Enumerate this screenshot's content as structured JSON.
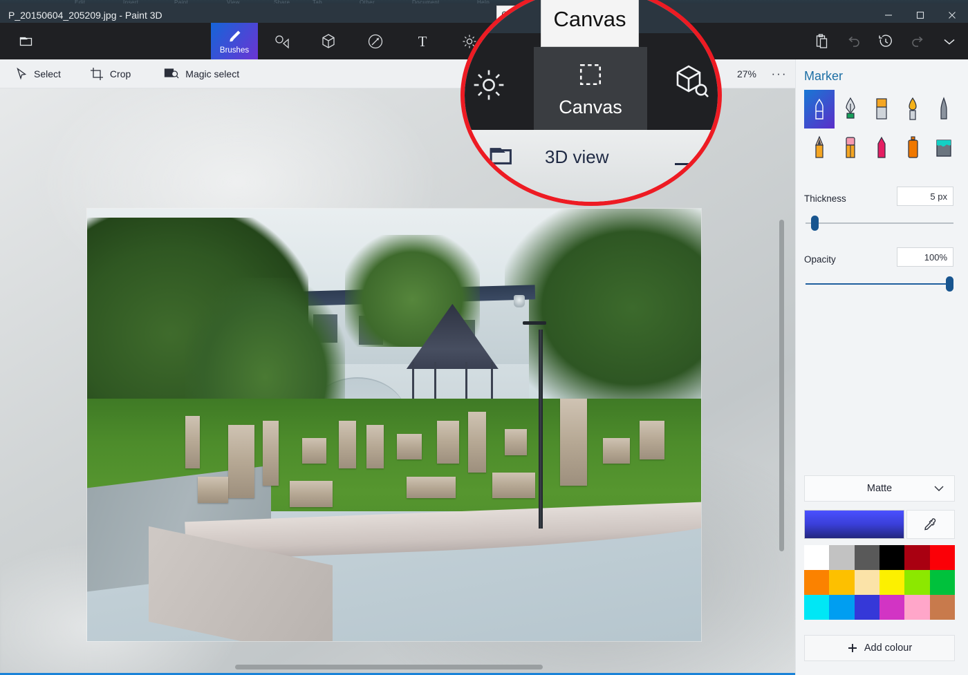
{
  "window": {
    "title": "P_20150604_205209.jpg  - Paint 3D",
    "controls": [
      {
        "name": "minimize",
        "glyph": "minimize-icon"
      },
      {
        "name": "maximize",
        "glyph": "maximize-icon"
      },
      {
        "name": "close",
        "glyph": "close-icon"
      }
    ],
    "behind_tabs": [
      "Edit",
      "Insert",
      "Paint",
      "View",
      "Share",
      "Tab",
      "Other",
      "Document",
      "Help"
    ]
  },
  "ribbon": {
    "menu_icon": "folder-icon",
    "tools": [
      {
        "label": "Brushes",
        "icon": "brush-icon",
        "active": true
      },
      {
        "label": "",
        "icon": "shapes-2d-icon",
        "active": false
      },
      {
        "label": "",
        "icon": "shapes-3d-icon",
        "active": false
      },
      {
        "label": "",
        "icon": "stickers-icon",
        "active": false
      },
      {
        "label": "",
        "icon": "text-icon",
        "active": false
      },
      {
        "label": "",
        "icon": "effects-icon",
        "active": false
      },
      {
        "label": "",
        "icon": "canvas-icon",
        "active": false
      },
      {
        "label": "",
        "icon": "3d-library-icon",
        "active": false
      }
    ],
    "right_actions": [
      {
        "name": "clipboard-icon",
        "dim": false
      },
      {
        "name": "undo-icon",
        "dim": true
      },
      {
        "name": "history-icon",
        "dim": false
      },
      {
        "name": "redo-icon",
        "dim": true
      },
      {
        "name": "chevron-down-icon",
        "dim": false
      }
    ]
  },
  "subbar": {
    "items": [
      {
        "label": "Select",
        "icon": "cursor-select-icon"
      },
      {
        "label": "Crop",
        "icon": "crop-icon"
      },
      {
        "label": "Magic select",
        "icon": "magic-select-icon"
      }
    ],
    "zoom": "27%",
    "more": "···"
  },
  "tooltip": {
    "small_label": "Canvas",
    "magnified_label": "Canvas",
    "tile_label": "Canvas",
    "view_label": "3D view"
  },
  "panel": {
    "title": "Marker",
    "brushes": [
      {
        "name": "marker-brush",
        "selected": true
      },
      {
        "name": "calligraphy-pen-brush",
        "selected": false
      },
      {
        "name": "oil-brush",
        "selected": false
      },
      {
        "name": "watercolor-brush",
        "selected": false
      },
      {
        "name": "pixel-pen-brush",
        "selected": false
      },
      {
        "name": "pencil-brush",
        "selected": false
      },
      {
        "name": "eraser-brush",
        "selected": false
      },
      {
        "name": "crayon-brush",
        "selected": false
      },
      {
        "name": "spray-can-brush",
        "selected": false
      },
      {
        "name": "fill-bucket-brush",
        "selected": false
      }
    ],
    "thickness": {
      "label": "Thickness",
      "value": "5 px",
      "percent": 4
    },
    "opacity": {
      "label": "Opacity",
      "value": "100%",
      "percent": 100
    },
    "material": {
      "value": "Matte",
      "chevron": "chevron-down-icon"
    },
    "current_colour": "#3a3fd8",
    "eyedropper": "eyedropper-icon",
    "swatches": [
      "#ffffff",
      "#c2c2c2",
      "#595959",
      "#000000",
      "#a90011",
      "#fb0007",
      "#fb8200",
      "#fdc000",
      "#fbe3a8",
      "#fcf000",
      "#8ce800",
      "#00c13c",
      "#00e7f5",
      "#009ef1",
      "#3538d8",
      "#d234c4",
      "#ffa6c9",
      "#c87a4c"
    ],
    "add_colour": {
      "label": "Add colour",
      "icon": "plus-icon"
    }
  },
  "canvas": {
    "image_description": "Photo of monastery grounds with stone monuments on grass, a gazebo, lamp post and paved plaza",
    "scrollbars": {
      "vertical": "vertical-scrollbar",
      "horizontal": "horizontal-scrollbar"
    }
  }
}
